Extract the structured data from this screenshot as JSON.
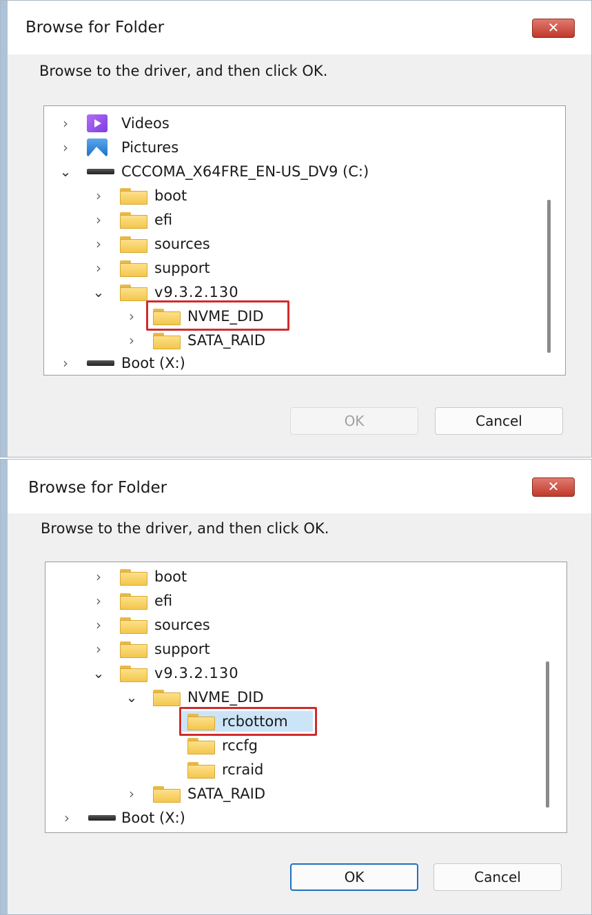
{
  "dialogs": [
    {
      "title": "Browse for Folder",
      "close_glyph": "✕",
      "instruction": "Browse to the driver, and then click OK.",
      "tree": [
        {
          "label": "Videos",
          "icon": "videos-icon",
          "expander": "collapsed"
        },
        {
          "label": "Pictures",
          "icon": "pictures-icon",
          "expander": "collapsed"
        },
        {
          "label": "CCCOMA_X64FRE_EN-US_DV9 (C:)",
          "icon": "drive-icon",
          "expander": "expanded"
        },
        {
          "label": "boot",
          "icon": "folder-icon",
          "expander": "collapsed"
        },
        {
          "label": "efi",
          "icon": "folder-icon",
          "expander": "collapsed"
        },
        {
          "label": "sources",
          "icon": "folder-icon",
          "expander": "collapsed"
        },
        {
          "label": "support",
          "icon": "folder-icon",
          "expander": "collapsed"
        },
        {
          "label": "v9.3.2.130",
          "icon": "folder-icon",
          "expander": "expanded"
        },
        {
          "label": "NVME_DID",
          "icon": "folder-icon",
          "expander": "collapsed",
          "highlighted": true
        },
        {
          "label": "SATA_RAID",
          "icon": "folder-icon",
          "expander": "collapsed"
        },
        {
          "label": "Boot (X:)",
          "icon": "drive-icon",
          "expander": "collapsed"
        }
      ],
      "ok_label": "OK",
      "ok_enabled": false,
      "cancel_label": "Cancel"
    },
    {
      "title": "Browse for Folder",
      "close_glyph": "✕",
      "instruction": "Browse to the driver, and then click OK.",
      "tree": [
        {
          "label": "boot",
          "icon": "folder-icon",
          "expander": "collapsed"
        },
        {
          "label": "efi",
          "icon": "folder-icon",
          "expander": "collapsed"
        },
        {
          "label": "sources",
          "icon": "folder-icon",
          "expander": "collapsed"
        },
        {
          "label": "support",
          "icon": "folder-icon",
          "expander": "collapsed"
        },
        {
          "label": "v9.3.2.130",
          "icon": "folder-icon",
          "expander": "expanded"
        },
        {
          "label": "NVME_DID",
          "icon": "folder-icon",
          "expander": "expanded"
        },
        {
          "label": "rcbottom",
          "icon": "folder-icon",
          "expander": "none",
          "selected": true,
          "highlighted": true
        },
        {
          "label": "rccfg",
          "icon": "folder-icon",
          "expander": "none"
        },
        {
          "label": "rcraid",
          "icon": "folder-icon",
          "expander": "none"
        },
        {
          "label": "SATA_RAID",
          "icon": "folder-icon",
          "expander": "collapsed"
        },
        {
          "label": "Boot (X:)",
          "icon": "drive-icon",
          "expander": "collapsed"
        }
      ],
      "ok_label": "OK",
      "ok_enabled": true,
      "cancel_label": "Cancel"
    }
  ],
  "colors": {
    "highlight_border": "#d02b2b",
    "selection": "#cce4f7",
    "close_button": "#c0392b",
    "default_button_border": "#1f6fbf"
  }
}
